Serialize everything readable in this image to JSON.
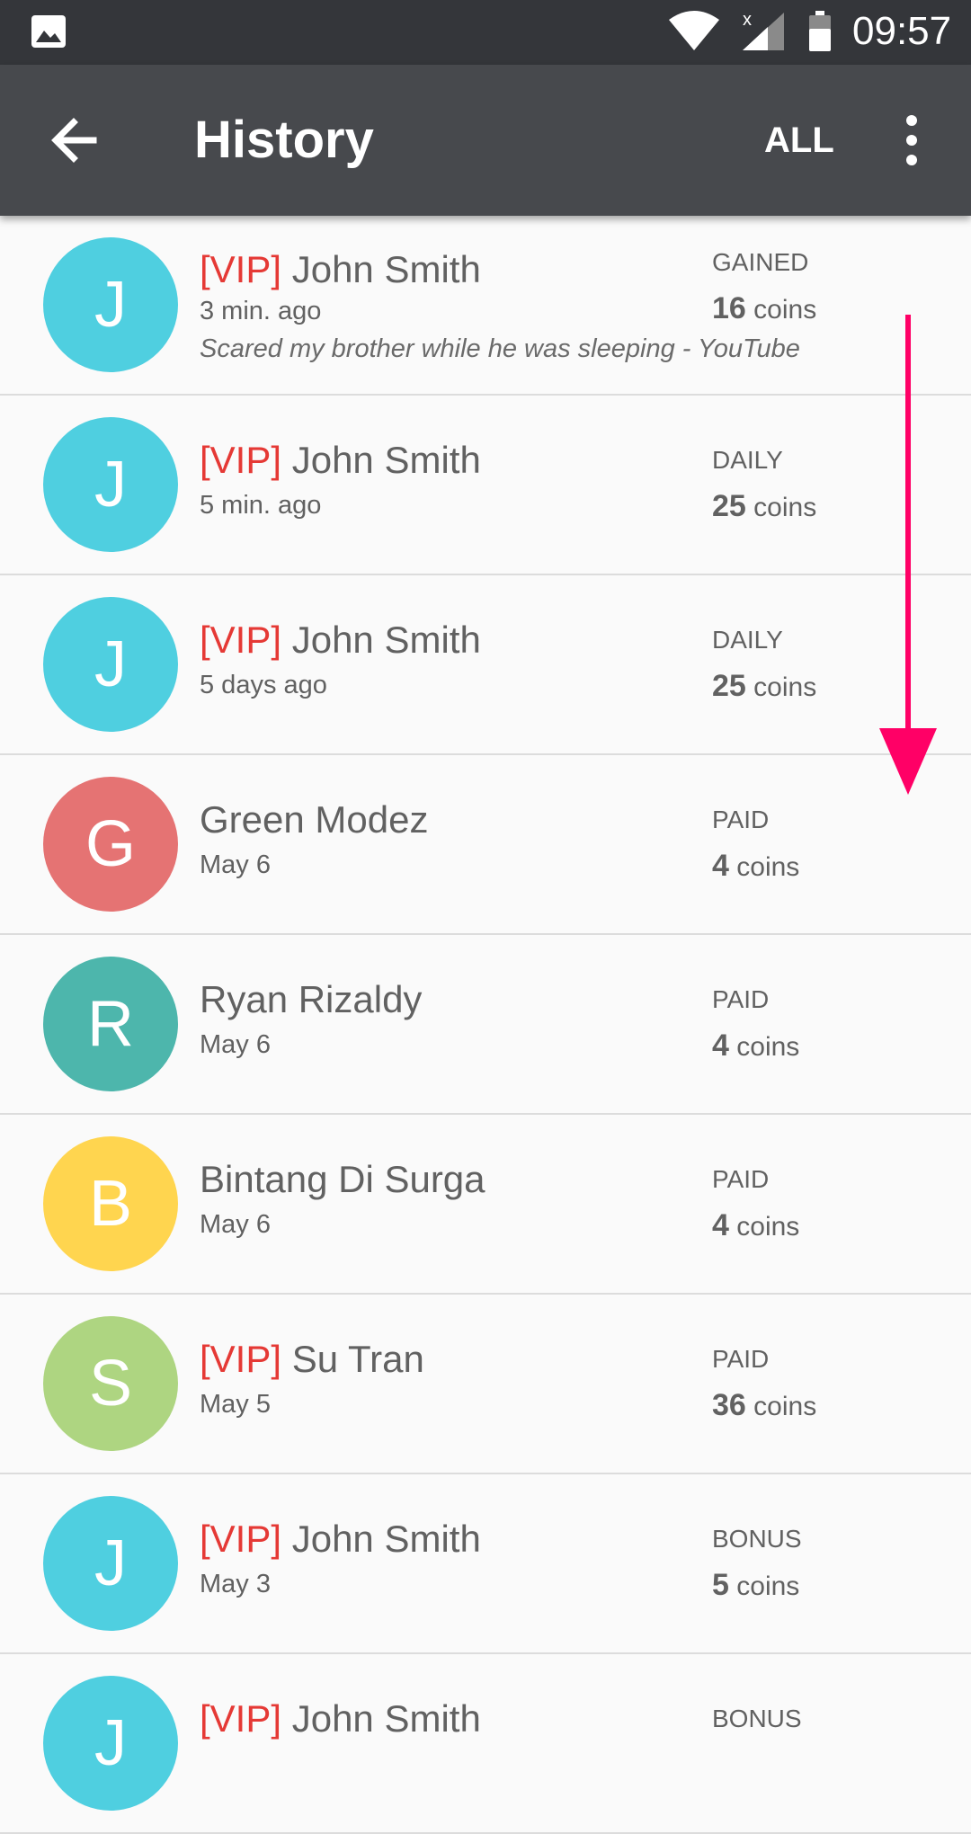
{
  "status_bar": {
    "time": "09:57"
  },
  "app_bar": {
    "title": "History",
    "filter_label": "ALL"
  },
  "colors": {
    "cyan": "#4fcfe0",
    "red": "#e57373",
    "teal": "#4db6ac",
    "yellow": "#ffd54f",
    "lightgreen": "#aed581",
    "vip": "#e53935",
    "arrow": "#ff0066"
  },
  "history": [
    {
      "initial": "J",
      "color": "#4fcfe0",
      "vip": "[VIP]",
      "name": "John Smith",
      "time": "3 min. ago",
      "description": "Scared my brother while he was sleeping - YouTube",
      "type": "GAINED",
      "amount": "16",
      "unit": "coins"
    },
    {
      "initial": "J",
      "color": "#4fcfe0",
      "vip": "[VIP]",
      "name": "John Smith",
      "time": "5 min. ago",
      "type": "DAILY",
      "amount": "25",
      "unit": "coins"
    },
    {
      "initial": "J",
      "color": "#4fcfe0",
      "vip": "[VIP]",
      "name": "John Smith",
      "time": "5 days ago",
      "type": "DAILY",
      "amount": "25",
      "unit": "coins"
    },
    {
      "initial": "G",
      "color": "#e57373",
      "vip": "",
      "name": "Green Modez",
      "time": "May 6",
      "type": "PAID",
      "amount": "4",
      "unit": "coins"
    },
    {
      "initial": "R",
      "color": "#4db6ac",
      "vip": "",
      "name": "Ryan Rizaldy",
      "time": "May 6",
      "type": "PAID",
      "amount": "4",
      "unit": "coins"
    },
    {
      "initial": "B",
      "color": "#ffd54f",
      "vip": "",
      "name": "Bintang Di Surga",
      "time": "May 6",
      "type": "PAID",
      "amount": "4",
      "unit": "coins"
    },
    {
      "initial": "S",
      "color": "#aed581",
      "vip": "[VIP]",
      "name": "Su Tran",
      "time": "May 5",
      "type": "PAID",
      "amount": "36",
      "unit": "coins"
    },
    {
      "initial": "J",
      "color": "#4fcfe0",
      "vip": "[VIP]",
      "name": "John Smith",
      "time": "May 3",
      "type": "BONUS",
      "amount": "5",
      "unit": "coins"
    },
    {
      "initial": "J",
      "color": "#4fcfe0",
      "vip": "[VIP]",
      "name": "John Smith",
      "time": "",
      "type": "BONUS",
      "amount": "",
      "unit": ""
    }
  ]
}
